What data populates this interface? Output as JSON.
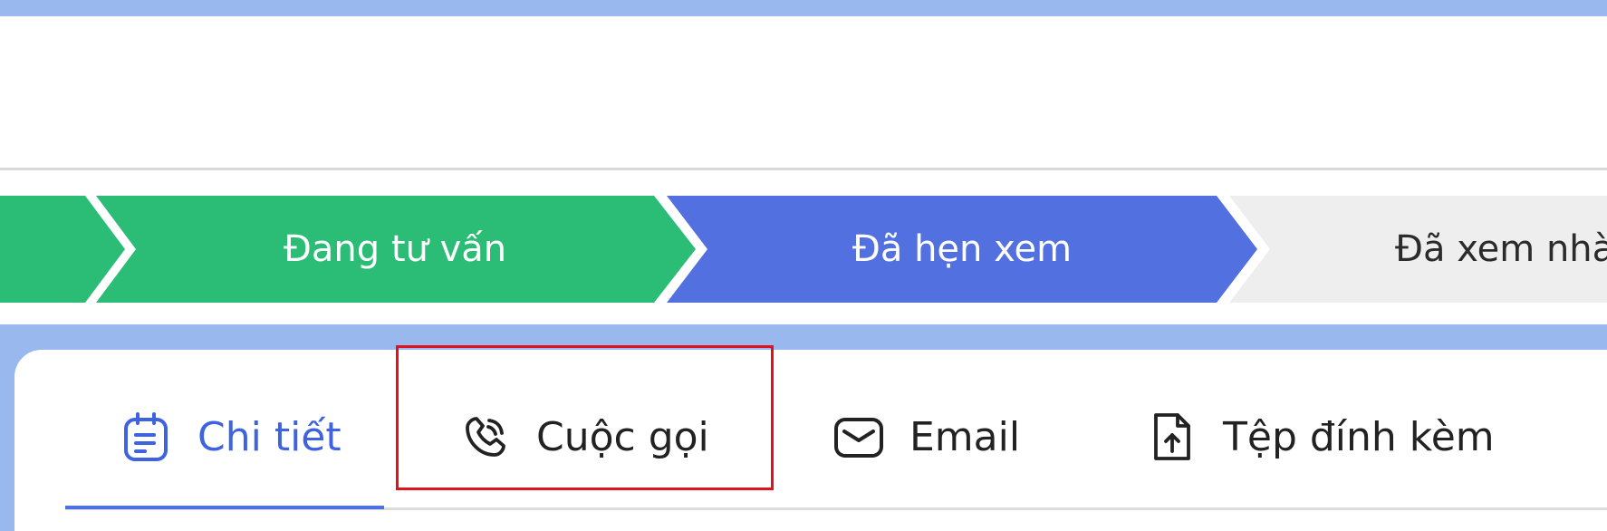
{
  "pipeline": {
    "stages": [
      {
        "label": "",
        "state": "completed"
      },
      {
        "label": "Đang tư vấn",
        "state": "completed"
      },
      {
        "label": "Đã hẹn xem",
        "state": "current"
      },
      {
        "label": "Đã xem nhà",
        "state": "upcoming"
      }
    ]
  },
  "tabs": [
    {
      "label": "Chi tiết",
      "icon": "calendar-note-icon",
      "active": true
    },
    {
      "label": "Cuộc gọi",
      "icon": "phone-call-icon",
      "active": false
    },
    {
      "label": "Email",
      "icon": "mail-icon",
      "active": false
    },
    {
      "label": "Tệp đính kèm",
      "icon": "file-upload-icon",
      "active": false
    }
  ],
  "colors": {
    "completed": "#2bbc76",
    "current": "#5270e0",
    "upcoming": "#eeeeee",
    "accent": "#3f63e0",
    "frame": "#98b8ee",
    "highlight": "#e0131d"
  }
}
